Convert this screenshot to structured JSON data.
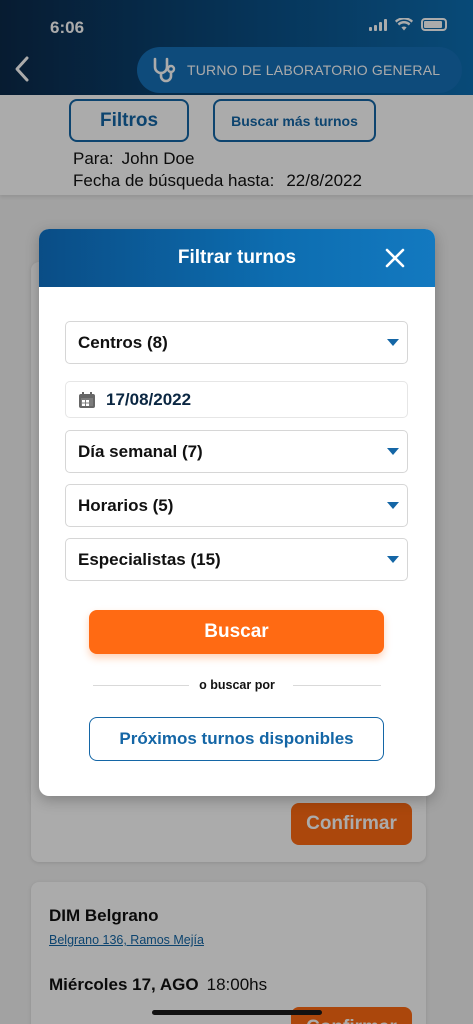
{
  "status_bar": {
    "time": "6:06"
  },
  "header": {
    "title": "TURNO DE LABORATORIO GENERAL"
  },
  "filter_bar": {
    "filtros_label": "Filtros",
    "buscar_mas_label": "Buscar más turnos",
    "para_label": "Para:",
    "para_value": "John Doe",
    "fecha_label": "Fecha de búsqueda hasta:",
    "fecha_value": "22/8/2022"
  },
  "cards": {
    "confirm_label": "Confirmar",
    "center_name": "DIM Belgrano",
    "center_address": "Belgrano 136, Ramos Mejía",
    "slot_day": "Miércoles 17, AGO",
    "slot_time": "18:00hs"
  },
  "modal": {
    "title": "Filtrar turnos",
    "centros": "Centros (8)",
    "fecha": "17/08/2022",
    "dia_semanal": "Día semanal (7)",
    "horarios": "Horarios (5)",
    "especialistas": "Especialistas (15)",
    "buscar_label": "Buscar",
    "or_text": "o buscar por",
    "proximos_label": "Próximos turnos disponibles"
  },
  "colors": {
    "primary": "#1466a6",
    "accent": "#ff6a13"
  }
}
